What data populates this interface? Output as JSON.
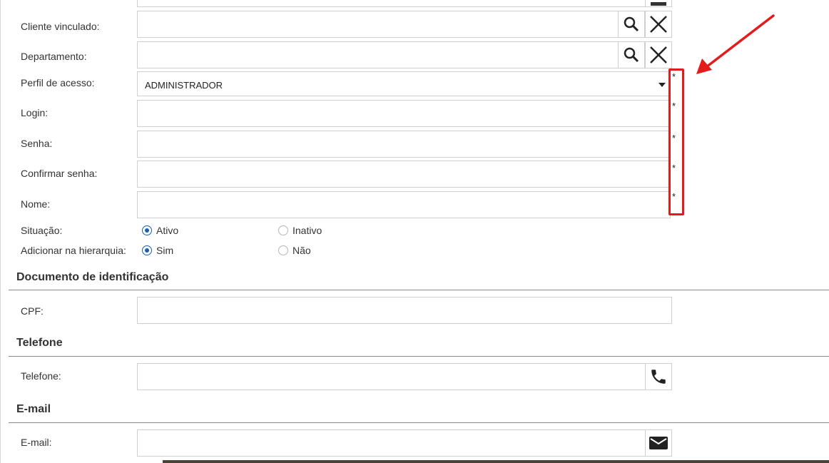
{
  "form": {
    "fields": {
      "cliente_vinculado": {
        "label": "Cliente vinculado:",
        "value": ""
      },
      "departamento": {
        "label": "Departamento:",
        "value": ""
      },
      "perfil_acesso": {
        "label": "Perfil de acesso:",
        "value": "ADMINISTRADOR"
      },
      "login": {
        "label": "Login:",
        "value": ""
      },
      "senha": {
        "label": "Senha:",
        "value": ""
      },
      "confirmar_senha": {
        "label": "Confirmar senha:",
        "value": ""
      },
      "nome": {
        "label": "Nome:",
        "value": ""
      }
    },
    "required_marker": "*",
    "situacao": {
      "label": "Situação:",
      "options": [
        "Ativo",
        "Inativo"
      ],
      "selected": "Ativo"
    },
    "hierarquia": {
      "label": "Adicionar na hierarquia:",
      "options": [
        "Sim",
        "Não"
      ],
      "selected": "Sim"
    }
  },
  "sections": {
    "documento": {
      "title": "Documento de identificação",
      "cpf_label": "CPF:",
      "cpf_value": ""
    },
    "telefone": {
      "title": "Telefone",
      "field_label": "Telefone:",
      "value": ""
    },
    "email": {
      "title": "E-mail",
      "field_label": "E-mail:",
      "value": ""
    }
  },
  "icons": {
    "search": "search-icon",
    "clear": "close-icon",
    "phone": "phone-icon",
    "mail": "envelope-icon",
    "dropdown": "caret-down-icon",
    "annotation": "red-arrow-annotation"
  },
  "colors": {
    "radio_selected": "#1b5fb4",
    "annotation": "#e31b1b",
    "border": "#cfcfcf"
  }
}
